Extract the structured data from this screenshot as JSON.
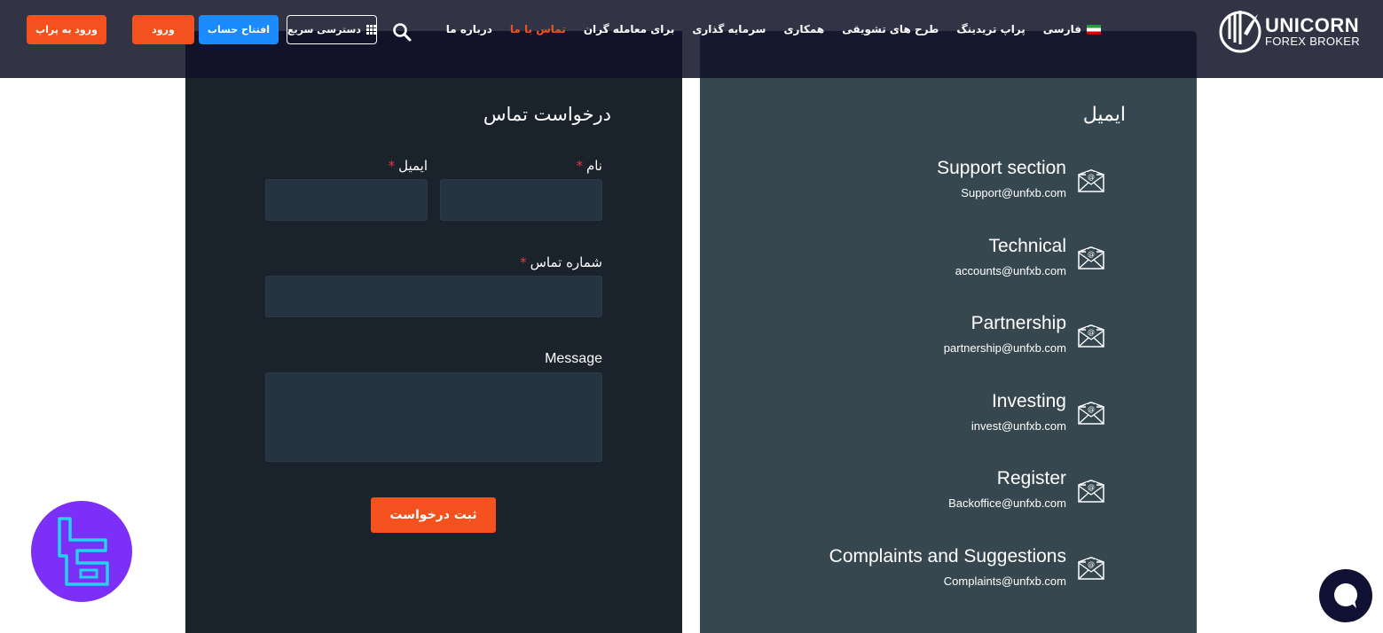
{
  "header": {
    "logo": {
      "line1": "UNICORN",
      "line2": "FOREX BROKER"
    },
    "nav": [
      {
        "label": "درباره ما",
        "active": false
      },
      {
        "label": "تماس با ما",
        "active": true
      },
      {
        "label": "برای معامله گران",
        "active": false
      },
      {
        "label": "سرمایه گذاری",
        "active": false
      },
      {
        "label": "همکاری",
        "active": false
      },
      {
        "label": "طرح های تشویقی",
        "active": false
      },
      {
        "label": "پراپ تریدینگ",
        "active": false
      },
      {
        "label": "فارسی",
        "active": false,
        "icon": "iran-flag-icon"
      }
    ],
    "quick_access": "دسترسی سریع",
    "open_account": "افتتاح حساب",
    "login": "ورود",
    "prop_login": "ورود به پراپ",
    "colors": {
      "accent": "#f4511e",
      "primary": "#1a8cff",
      "header_bg": "#1e1e32"
    }
  },
  "form": {
    "title": "درخواست تماس",
    "name_label": "نام",
    "email_label": "ایمیل",
    "phone_label": "شماره تماس",
    "message_label": "Message",
    "required_mark": "*",
    "submit": "ثبت درخواست"
  },
  "emails": {
    "title": "ایمیل",
    "items": [
      {
        "name": "Support section",
        "address": "Support@unfxb.com"
      },
      {
        "name": "Technical",
        "address": "accounts@unfxb.com"
      },
      {
        "name": "Partnership",
        "address": "partnership@unfxb.com"
      },
      {
        "name": "Investing",
        "address": "invest@unfxb.com"
      },
      {
        "name": "Register",
        "address": "Backoffice@unfxb.com"
      },
      {
        "name": "Complaints and Suggestions",
        "address": "Complaints@unfxb.com"
      }
    ]
  }
}
